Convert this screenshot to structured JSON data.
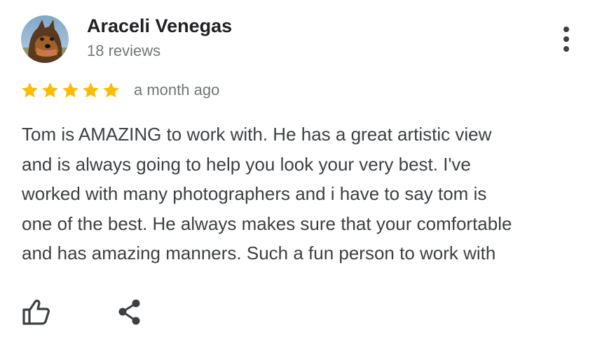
{
  "reviewer": {
    "name": "Araceli Venegas",
    "review_count": "18 reviews",
    "avatar_icon": "dog-photo-avatar"
  },
  "review": {
    "rating": 5,
    "rating_max": 5,
    "star_color": "#fbbc04",
    "time_ago": "a month ago",
    "text_lines": [
      "Tom is AMAZING to work with. He has a great artistic view",
      "and is always going to help you look your very best. I've",
      "worked with many photographers and i have to say tom is",
      "one of the best. He always makes sure that your comfortable",
      "and has amazing manners. Such a fun person to work with"
    ]
  },
  "actions": {
    "more_icon": "more-vert-icon",
    "like_icon": "thumbs-up-icon",
    "share_icon": "share-icon"
  },
  "colors": {
    "name": "#202124",
    "secondary": "#70757a",
    "body_text": "#3c4043",
    "icon": "#3c4043"
  }
}
